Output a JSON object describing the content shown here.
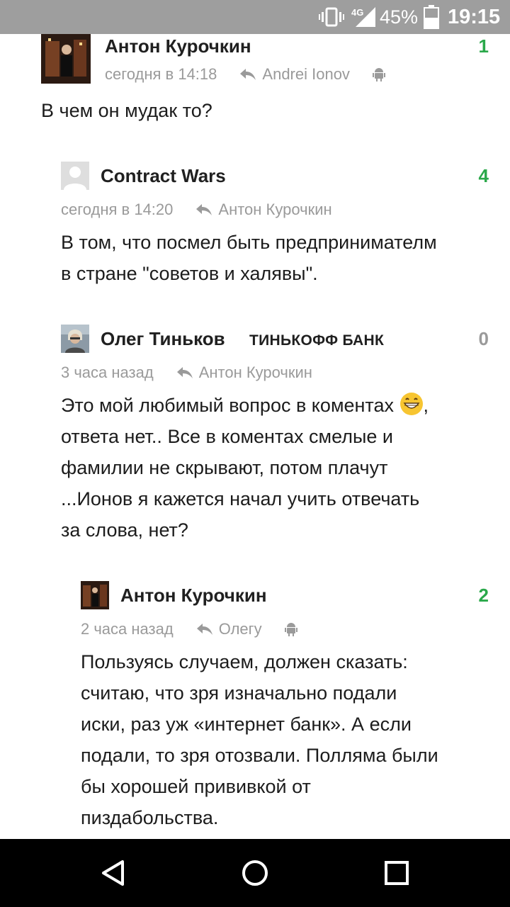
{
  "status_bar": {
    "battery_pct": "45%",
    "time": "19:15",
    "network": "4G",
    "icons": [
      "vibrate-icon",
      "signal-icon",
      "battery-icon"
    ]
  },
  "comments": [
    {
      "author": "Антон Курочкин",
      "score": "1",
      "time": "сегодня в 14:18",
      "reply_to": "Andrei Ionov",
      "platform_icon": "android-icon",
      "text": "В чем он мудак то?"
    },
    {
      "author": "Contract Wars",
      "score": "4",
      "time": "сегодня в 14:20",
      "reply_to": "Антон Курочкин",
      "text": "В том, что посмел быть предпринимателм\nв стране \"советов и халявы\"."
    },
    {
      "author": "Олег Тиньков",
      "badge": "ТИНЬКОФФ БАНК",
      "score": "0",
      "time": "3 часа назад",
      "reply_to": "Антон Курочкин",
      "text_before_emoji": "Это мой любимый вопрос в коментах ",
      "text_after_emoji": ",\nответа нет.. Все в коментах смелые и\nфамилии не скрывают, потом плачут\n...Ионов я кажется начал учить отвечать\nза слова, нет?",
      "emoji": "grinning-face-emoji"
    },
    {
      "author": "Антон Курочкин",
      "score": "2",
      "time": "2 часа назад",
      "reply_to": "Олегу",
      "platform_icon": "android-icon",
      "text": "Пользуясь случаем, должен сказать:\nсчитаю, что зря изначально подали\nиски, раз уж «интернет банк». А если\nподали, то зря отозвали. Полляма были\nбы хорошей прививкой от\nпиздабольства."
    }
  ],
  "nav_bar": {
    "icons": [
      "back-icon",
      "home-icon",
      "recents-icon"
    ]
  },
  "colors": {
    "status_bar_bg": "#9e9e9e",
    "score_positive": "#2aa84a",
    "meta_gray": "#9a9a9a",
    "nav_bar_bg": "#000000"
  }
}
